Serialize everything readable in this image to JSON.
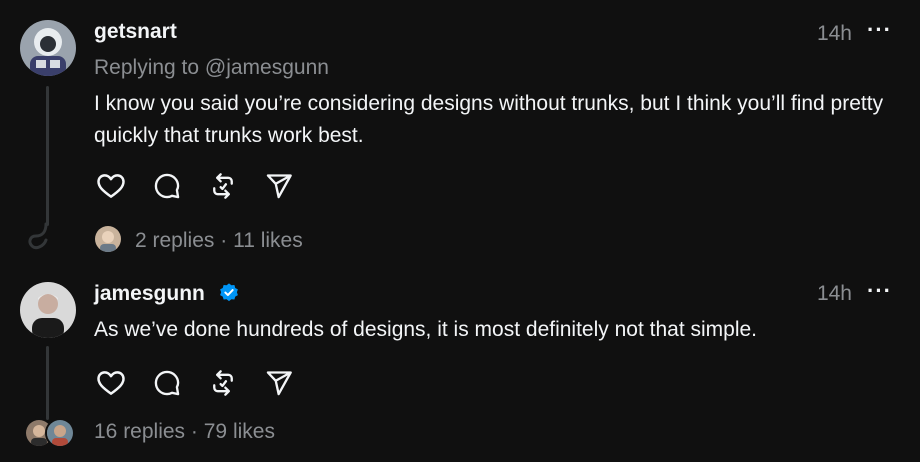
{
  "posts": [
    {
      "username": "getsnart",
      "time": "14h",
      "more": "···",
      "replying_to": "Replying to @jamesgunn",
      "text": "I know you said you’re considering designs without trunks, but I think you’ll find pretty quickly that trunks work best.",
      "replies": "2 replies",
      "likes": "11 likes",
      "separator": "·"
    },
    {
      "username": "jamesgunn",
      "verified": true,
      "time": "14h",
      "more": "···",
      "text": "As we’ve done hundreds of designs, it is most definitely not that simple.",
      "replies": "16 replies",
      "likes": "79 likes",
      "separator": "·"
    }
  ],
  "icons": {
    "like": "heart-icon",
    "comment": "comment-icon",
    "repost": "repost-icon",
    "share": "send-icon",
    "verified": "verified-badge-icon"
  },
  "colors": {
    "background": "#101010",
    "primary_text": "#f3f5f7",
    "secondary_text": "#8b8e92",
    "verified": "#0095f6",
    "thread_line": "#333638"
  }
}
